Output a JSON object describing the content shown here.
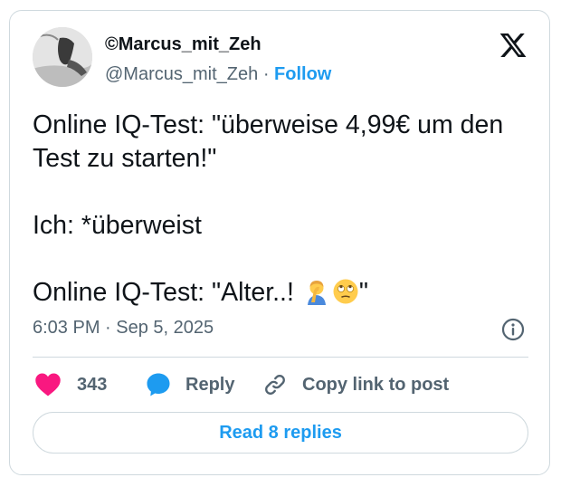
{
  "author": {
    "display_name": "©Marcus_mit_Zeh",
    "handle": "@Marcus_mit_Zeh",
    "separator": "·",
    "follow_label": "Follow"
  },
  "tweet": {
    "line1": "Online IQ-Test: \"überweise 4,99€ um den Test zu starten!\"",
    "line2": "Ich: *überweist",
    "line3_text": "Online IQ-Test: \"Alter..! ",
    "line3_end": "\"",
    "line3_emojis": [
      "person-facepalming-icon",
      "face-with-rolling-eyes-icon"
    ],
    "time": "6:03 PM",
    "separator": "·",
    "date": "Sep 5, 2025"
  },
  "actions": {
    "like_count": "343",
    "reply_label": "Reply",
    "copy_label": "Copy link to post"
  },
  "read_replies_label": "Read 8 replies",
  "colors": {
    "accent": "#1d9bf0",
    "like": "#f91880",
    "text": "#0f1419",
    "muted": "#536471",
    "border": "#cfd9de"
  },
  "icons": [
    "x-logo-icon",
    "info-icon",
    "heart-icon",
    "reply-bubble-icon",
    "link-icon"
  ]
}
